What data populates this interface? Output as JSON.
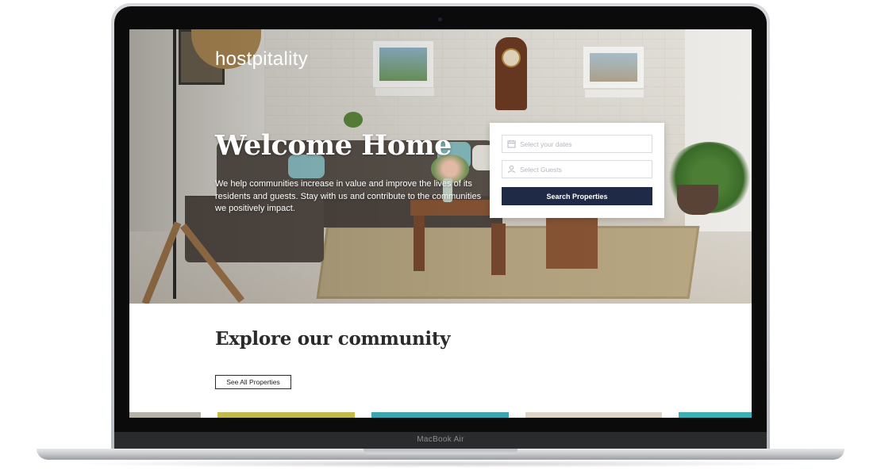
{
  "device": {
    "label": "MacBook Air"
  },
  "site": {
    "logo_text": "hostpitality"
  },
  "hero": {
    "title": "Welcome Home",
    "subtitle": "We help communities increase in value and improve the lives of its residents and guests. Stay with us and contribute to the communities we positively impact."
  },
  "search": {
    "dates_placeholder": "Select your dates",
    "guests_placeholder": "Select Guests",
    "button_label": "Search Properties",
    "button_color": "#1f2b46"
  },
  "explore": {
    "title": "Explore our community",
    "button_label": "See All Properties"
  },
  "property_thumbnails": [
    {
      "color": "#b7b2a9"
    },
    {
      "color": "#c2bb4a"
    },
    {
      "color": "#3aa6b0"
    },
    {
      "color": "#ded4c8"
    },
    {
      "color": "#3bb0b5"
    }
  ]
}
